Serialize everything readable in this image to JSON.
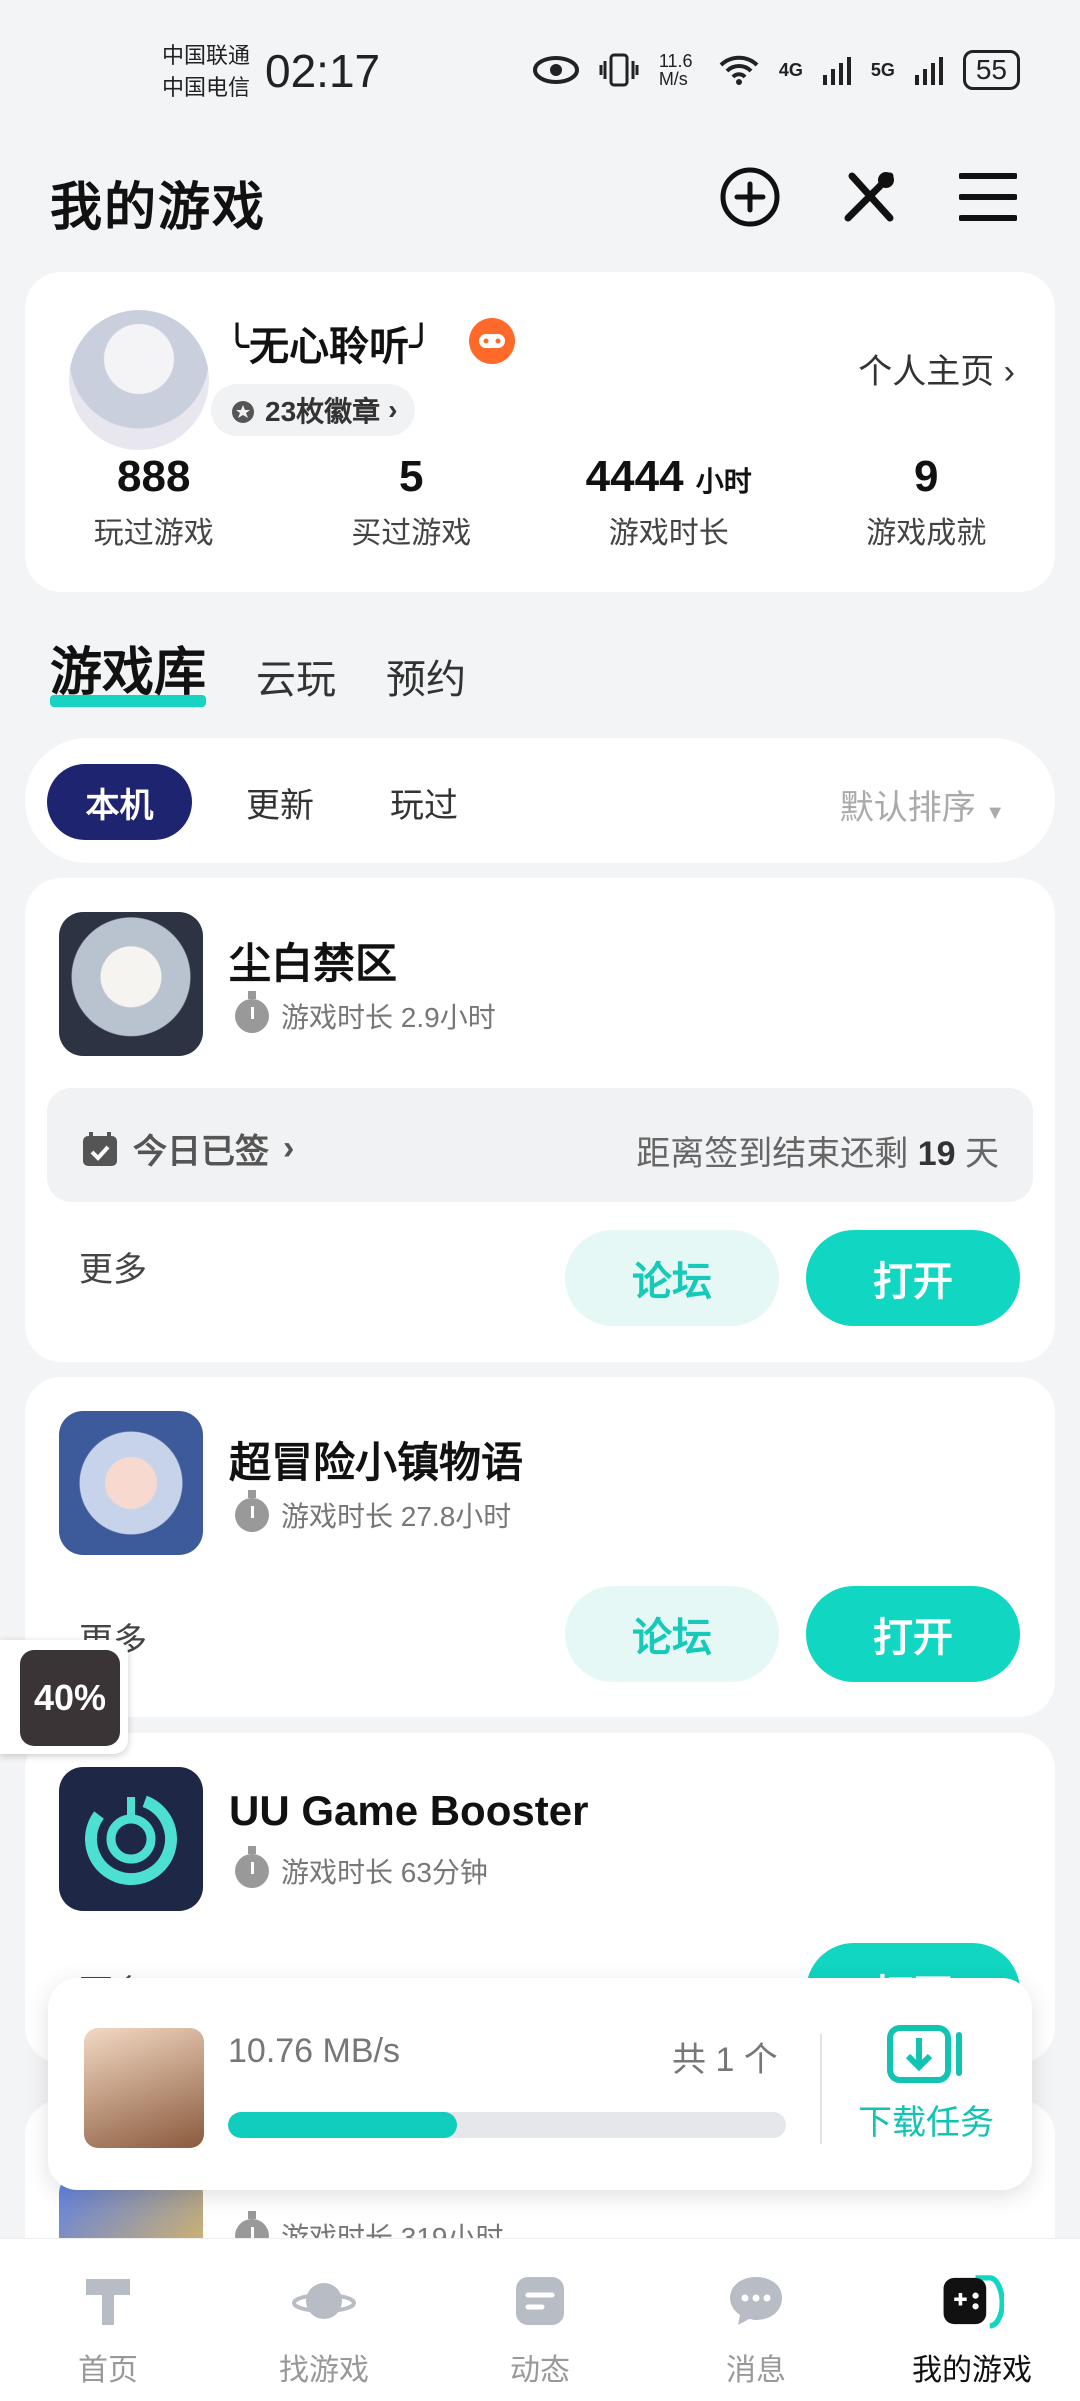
{
  "status_bar": {
    "carrier1": "中国联通",
    "carrier2": "中国电信",
    "time": "02:17",
    "speed": "11.6 M/s",
    "net1": "4G",
    "net2": "5G",
    "battery": "55"
  },
  "header": {
    "title": "我的游戏",
    "icons": [
      "add-circle-icon",
      "tools-icon",
      "menu-icon"
    ]
  },
  "profile": {
    "username": "╰无心聆听╯",
    "medals": "23枚徽章",
    "homepage": "个人主页",
    "stats": [
      {
        "value": "888",
        "unit": "",
        "label": "玩过游戏"
      },
      {
        "value": "5",
        "unit": "",
        "label": "买过游戏"
      },
      {
        "value": "4444",
        "unit": "小时",
        "label": "游戏时长"
      },
      {
        "value": "9",
        "unit": "",
        "label": "游戏成就"
      }
    ]
  },
  "tabs": [
    "游戏库",
    "云玩",
    "预约"
  ],
  "filters": {
    "chips": [
      "本机",
      "更新",
      "玩过"
    ],
    "sort": "默认排序"
  },
  "games": [
    {
      "name": "尘白禁区",
      "playtime": "游戏时长 2.9小时",
      "sign_label": "今日已签",
      "sign_prefix": "距离签到结束还剩",
      "sign_days": "19",
      "sign_suffix": "天",
      "more": "更多",
      "forum": "论坛",
      "open": "打开"
    },
    {
      "name": "超冒险小镇物语",
      "playtime": "游戏时长 27.8小时",
      "more": "更多",
      "forum": "论坛",
      "open": "打开"
    },
    {
      "name": "UU Game Booster",
      "playtime": "游戏时长 63分钟",
      "more": "更多",
      "open": "打开"
    },
    {
      "playtime": "游戏时长 319小时"
    }
  ],
  "floating": {
    "label": "40%"
  },
  "download": {
    "speed": "10.76 MB/s",
    "count": "共 1 个",
    "progress": 0.41,
    "task_label": "下载任务"
  },
  "nav": [
    "首页",
    "找游戏",
    "动态",
    "消息",
    "我的游戏"
  ],
  "colors": {
    "accent": "#10d6c2",
    "chip_active": "#1e2470",
    "badge": "#ff6a2a"
  }
}
